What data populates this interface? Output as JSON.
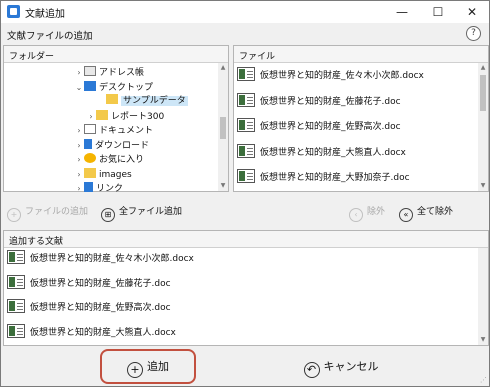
{
  "window": {
    "title": "文献追加",
    "minimize": "—",
    "maximize": "☐",
    "close": "✕"
  },
  "header": {
    "title": "文献ファイルの追加",
    "help": "?"
  },
  "folder_panel": {
    "title": "フォルダー",
    "items": [
      {
        "label": "アドレス帳",
        "chevron": "›",
        "icon": "address-book-icon"
      },
      {
        "label": "デスクトップ",
        "chevron": "⌄",
        "icon": "desktop-icon"
      },
      {
        "label": "サンプルデータ",
        "chevron": "",
        "icon": "folder-icon",
        "selected": true
      },
      {
        "label": "レポート300",
        "chevron": "›",
        "icon": "folder-icon"
      },
      {
        "label": "ドキュメント",
        "chevron": "›",
        "icon": "documents-icon"
      },
      {
        "label": "ダウンロード",
        "chevron": "›",
        "icon": "download-icon"
      },
      {
        "label": "お気に入り",
        "chevron": "›",
        "icon": "favorites-icon"
      },
      {
        "label": "images",
        "chevron": "›",
        "icon": "folder-icon"
      },
      {
        "label": "リンク",
        "chevron": "›",
        "icon": "links-icon"
      }
    ]
  },
  "file_panel": {
    "title": "ファイル",
    "files": [
      "仮想世界と知的財産_佐々木小次郎.docx",
      "仮想世界と知的財産_佐藤花子.doc",
      "仮想世界と知的財産_佐野高次.doc",
      "仮想世界と知的財産_大熊直人.docx",
      "仮想世界と知的財産_大野加奈子.doc"
    ]
  },
  "actions": {
    "add_file": "ファイルの追加",
    "add_all": "全ファイル追加",
    "remove": "除外",
    "remove_all": "全て除外"
  },
  "added_panel": {
    "title": "追加する文献",
    "files": [
      "仮想世界と知的財産_佐々木小次郎.docx",
      "仮想世界と知的財産_佐藤花子.doc",
      "仮想世界と知的財産_佐野高次.doc",
      "仮想世界と知的財産_大熊直人.docx"
    ]
  },
  "footer": {
    "add": "追加",
    "cancel": "キャンセル"
  },
  "colors": {
    "accent": "#2b79d6",
    "highlight": "#c2503f",
    "selection": "#cde6f7"
  }
}
